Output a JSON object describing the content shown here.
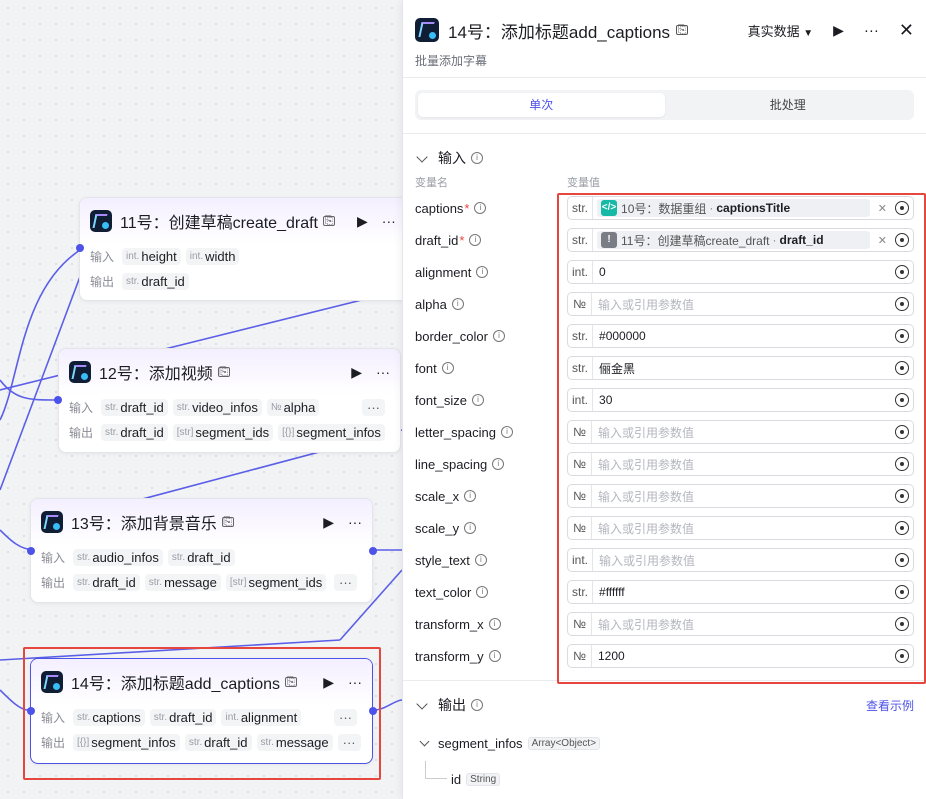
{
  "nodes": {
    "n11": {
      "title": "11号：创建草稿create_draft",
      "input_label": "输入",
      "output_label": "输出",
      "inputs": [
        {
          "type": "int.",
          "name": "height"
        },
        {
          "type": "int.",
          "name": "width"
        }
      ],
      "outputs": [
        {
          "type": "str.",
          "name": "draft_id"
        }
      ]
    },
    "n12": {
      "title": "12号：添加视频",
      "input_label": "输入",
      "output_label": "输出",
      "inputs": [
        {
          "type": "str.",
          "name": "draft_id"
        },
        {
          "type": "str.",
          "name": "video_infos"
        },
        {
          "type": "№",
          "name": "alpha"
        }
      ],
      "outputs": [
        {
          "type": "str.",
          "name": "draft_id"
        },
        {
          "type": "[str]",
          "name": "segment_ids"
        },
        {
          "type": "[{}]",
          "name": "segment_infos"
        }
      ],
      "more": "···"
    },
    "n13": {
      "title": "13号：添加背景音乐",
      "input_label": "输入",
      "output_label": "输出",
      "inputs": [
        {
          "type": "str.",
          "name": "audio_infos"
        },
        {
          "type": "str.",
          "name": "draft_id"
        }
      ],
      "outputs": [
        {
          "type": "str.",
          "name": "draft_id"
        },
        {
          "type": "str.",
          "name": "message"
        },
        {
          "type": "[str]",
          "name": "segment_ids"
        }
      ],
      "more": "···"
    },
    "n14": {
      "title": "14号：添加标题add_captions",
      "input_label": "输入",
      "output_label": "输出",
      "inputs": [
        {
          "type": "str.",
          "name": "captions"
        },
        {
          "type": "str.",
          "name": "draft_id"
        },
        {
          "type": "int.",
          "name": "alignment"
        }
      ],
      "outputs": [
        {
          "type": "[{}]",
          "name": "segment_infos"
        },
        {
          "type": "str.",
          "name": "draft_id"
        },
        {
          "type": "str.",
          "name": "message"
        }
      ],
      "more": "···"
    }
  },
  "panel": {
    "title": "14号：添加标题add_captions",
    "description": "批量添加字幕",
    "mode": "真实数据",
    "tabs": {
      "single": "单次",
      "batch": "批处理"
    },
    "input_section": "输入",
    "col_name": "变量名",
    "col_value": "变量值",
    "inputs": [
      {
        "name": "captions",
        "required": "*",
        "type": "str.",
        "ref": {
          "node": "10号：数据重组",
          "sep": "·",
          "var": "captionsTitle"
        },
        "ref_icon": "code-icon"
      },
      {
        "name": "draft_id",
        "required": "*",
        "type": "str.",
        "ref": {
          "node": "11号：创建草稿create_draft",
          "sep": "·",
          "var": "draft_id"
        },
        "ref_icon": "warning-icon"
      },
      {
        "name": "alignment",
        "type": "int.",
        "value": "0"
      },
      {
        "name": "alpha",
        "type": "№",
        "placeholder": "输入或引用参数值"
      },
      {
        "name": "border_color",
        "type": "str.",
        "value": "#000000"
      },
      {
        "name": "font",
        "type": "str.",
        "value": "俪金黑"
      },
      {
        "name": "font_size",
        "type": "int.",
        "value": "30"
      },
      {
        "name": "letter_spacing",
        "type": "№",
        "placeholder": "输入或引用参数值"
      },
      {
        "name": "line_spacing",
        "type": "№",
        "placeholder": "输入或引用参数值"
      },
      {
        "name": "scale_x",
        "type": "№",
        "placeholder": "输入或引用参数值"
      },
      {
        "name": "scale_y",
        "type": "№",
        "placeholder": "输入或引用参数值"
      },
      {
        "name": "style_text",
        "type": "int.",
        "placeholder": "输入或引用参数值"
      },
      {
        "name": "text_color",
        "type": "str.",
        "value": "#ffffff"
      },
      {
        "name": "transform_x",
        "type": "№",
        "placeholder": "输入或引用参数值"
      },
      {
        "name": "transform_y",
        "type": "№",
        "value": "1200"
      }
    ],
    "output_section": "输出",
    "view_example": "查看示例",
    "outputs": {
      "name": "segment_infos",
      "type": "Array<Object>",
      "child": {
        "name": "id",
        "type": "String"
      }
    }
  },
  "colors": {
    "accent": "#4d53e8",
    "highlight": "#e5473e"
  }
}
